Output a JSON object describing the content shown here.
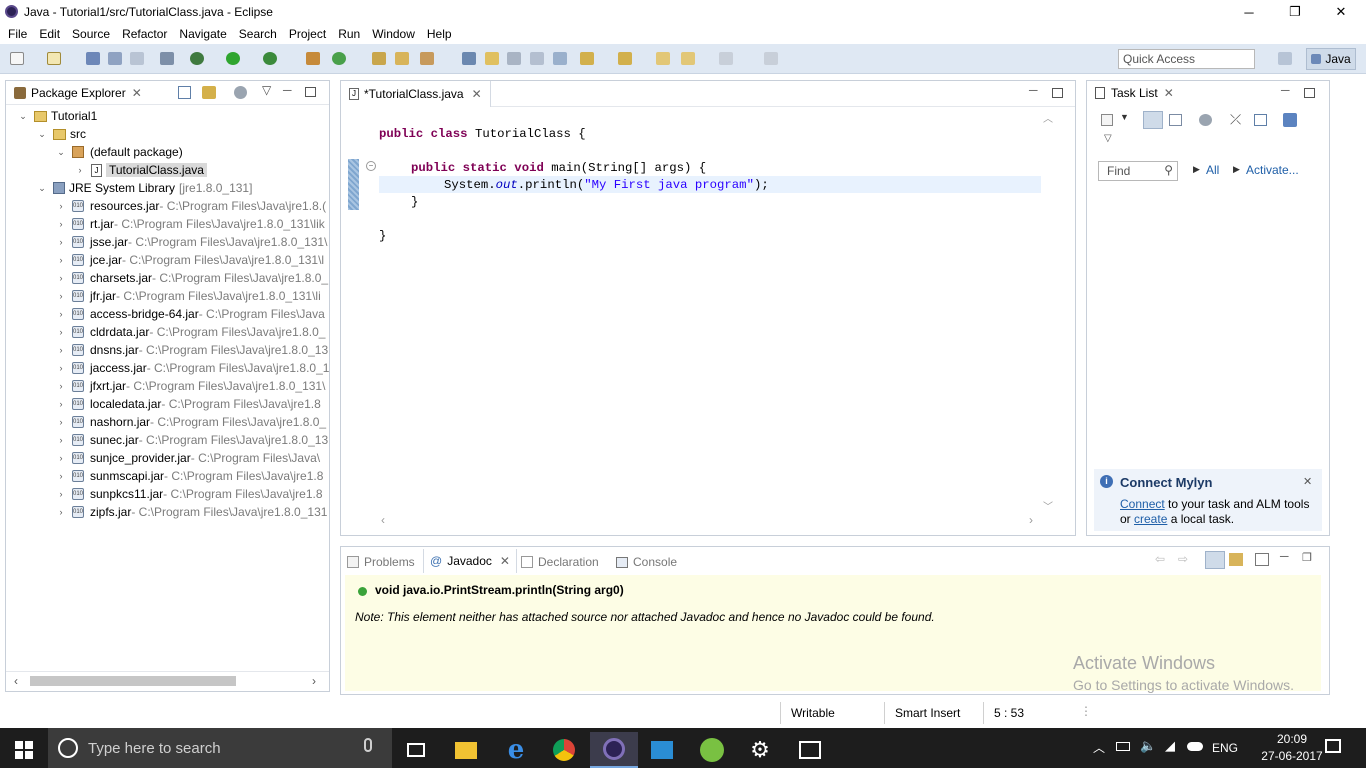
{
  "window": {
    "title": "Java - Tutorial1/src/TutorialClass.java - Eclipse",
    "minimize": "─",
    "restore": "❐",
    "close": "✕"
  },
  "menu": [
    "File",
    "Edit",
    "Source",
    "Refactor",
    "Navigate",
    "Search",
    "Project",
    "Run",
    "Window",
    "Help"
  ],
  "toolbar": {
    "quick_access_placeholder": "Quick Access",
    "perspective": "Java"
  },
  "package_explorer": {
    "title": "Package Explorer",
    "project": "Tutorial1",
    "src": "src",
    "package": "(default package)",
    "file": "TutorialClass.java",
    "jre": "JRE System Library",
    "jre_version": "[jre1.8.0_131]",
    "jars": [
      {
        "name": "resources.jar",
        "path": " - C:\\Program Files\\Java\\jre1.8.("
      },
      {
        "name": "rt.jar",
        "path": " - C:\\Program Files\\Java\\jre1.8.0_131\\lik"
      },
      {
        "name": "jsse.jar",
        "path": " - C:\\Program Files\\Java\\jre1.8.0_131\\"
      },
      {
        "name": "jce.jar",
        "path": " - C:\\Program Files\\Java\\jre1.8.0_131\\l"
      },
      {
        "name": "charsets.jar",
        "path": " - C:\\Program Files\\Java\\jre1.8.0_"
      },
      {
        "name": "jfr.jar",
        "path": " - C:\\Program Files\\Java\\jre1.8.0_131\\li"
      },
      {
        "name": "access-bridge-64.jar",
        "path": " - C:\\Program Files\\Java"
      },
      {
        "name": "cldrdata.jar",
        "path": " - C:\\Program Files\\Java\\jre1.8.0_"
      },
      {
        "name": "dnsns.jar",
        "path": " - C:\\Program Files\\Java\\jre1.8.0_13"
      },
      {
        "name": "jaccess.jar",
        "path": " - C:\\Program Files\\Java\\jre1.8.0_1"
      },
      {
        "name": "jfxrt.jar",
        "path": " - C:\\Program Files\\Java\\jre1.8.0_131\\"
      },
      {
        "name": "localedata.jar",
        "path": " - C:\\Program Files\\Java\\jre1.8"
      },
      {
        "name": "nashorn.jar",
        "path": " - C:\\Program Files\\Java\\jre1.8.0_"
      },
      {
        "name": "sunec.jar",
        "path": " - C:\\Program Files\\Java\\jre1.8.0_13"
      },
      {
        "name": "sunjce_provider.jar",
        "path": " - C:\\Program Files\\Java\\"
      },
      {
        "name": "sunmscapi.jar",
        "path": " - C:\\Program Files\\Java\\jre1.8"
      },
      {
        "name": "sunpkcs11.jar",
        "path": " - C:\\Program Files\\Java\\jre1.8"
      },
      {
        "name": "zipfs.jar",
        "path": " - C:\\Program Files\\Java\\jre1.8.0_131"
      }
    ]
  },
  "editor": {
    "tab": "*TutorialClass.java",
    "line1": {
      "kw": "public class",
      "rest": " TutorialClass {"
    },
    "line2": {
      "kw": "public static void",
      "rest": " main(String[] args) {"
    },
    "line3": {
      "pre": "System.",
      "field": "out",
      "mid": ".println(",
      "str": "\"My First java program\"",
      "end": ");"
    },
    "line4": "}",
    "line5": "}"
  },
  "task_list": {
    "title": "Task List",
    "find_placeholder": "Find",
    "all": "All",
    "activate": "Activate...",
    "mylyn_title": "Connect Mylyn",
    "mylyn_link1": "Connect",
    "mylyn_text1": " to your task and ALM tools",
    "mylyn_text2": "or ",
    "mylyn_link2": "create",
    "mylyn_text3": " a local task."
  },
  "bottom": {
    "tabs": [
      "Problems",
      "Javadoc",
      "Declaration",
      "Console"
    ],
    "signature": "void java.io.PrintStream.println(String arg0)",
    "note": "Note: This element neither has attached source nor attached Javadoc and hence no Javadoc could be found."
  },
  "watermark": {
    "line1": "Activate Windows",
    "line2": "Go to Settings to activate Windows."
  },
  "status": {
    "writable": "Writable",
    "insert": "Smart Insert",
    "position": "5 : 53"
  },
  "taskbar": {
    "search_placeholder": "Type here to search",
    "lang": "ENG",
    "time": "20:09",
    "date": "27-06-2017"
  },
  "colors": {
    "toolbar_bg": "#dfe8f3",
    "keyword": "#7f0055",
    "string": "#2a00ff",
    "javadoc_bg": "#fdfde5",
    "taskbar_bg": "#1d1d1d"
  }
}
